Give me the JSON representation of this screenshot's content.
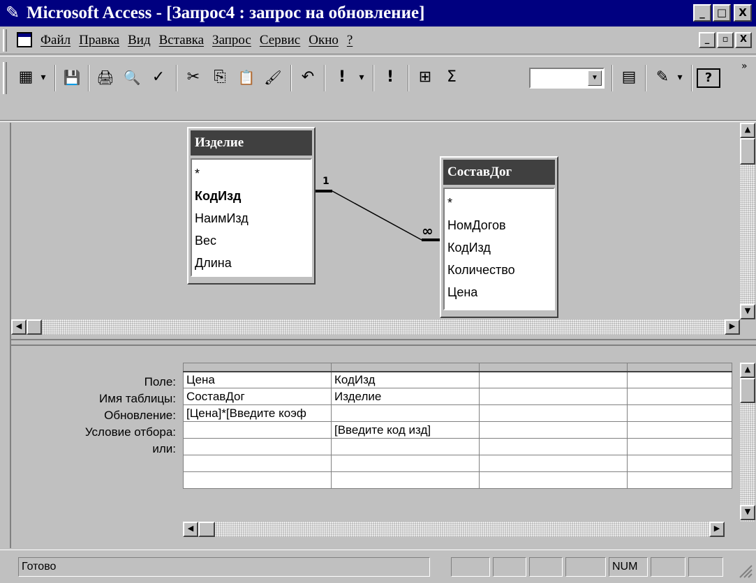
{
  "window": {
    "title": "Microsoft Access - [Запрос4 : запрос на обновление]",
    "buttons": [
      "_",
      "□",
      "X"
    ]
  },
  "menubar": {
    "items": [
      "Файл",
      "Правка",
      "Вид",
      "Вставка",
      "Запрос",
      "Сервис",
      "Окно",
      "?"
    ],
    "mdi_buttons": [
      "_",
      "▫",
      "X"
    ]
  },
  "toolbar": {
    "buttons": [
      {
        "name": "view-icon",
        "glyph": "▦"
      },
      {
        "name": "dropdown-arrow-icon",
        "glyph": "▾"
      },
      {
        "name": "save-icon",
        "glyph": "💾"
      },
      {
        "name": "print-icon",
        "glyph": "🖨"
      },
      {
        "name": "print-preview-icon",
        "glyph": "🔍"
      },
      {
        "name": "spelling-icon",
        "glyph": "✓"
      },
      {
        "name": "cut-icon",
        "glyph": "✂"
      },
      {
        "name": "copy-icon",
        "glyph": "⎘"
      },
      {
        "name": "paste-icon",
        "glyph": "📋"
      },
      {
        "name": "format-painter-icon",
        "glyph": "🖌"
      },
      {
        "name": "undo-icon",
        "glyph": "↶"
      },
      {
        "name": "query-type-icon",
        "glyph": "!"
      },
      {
        "name": "run-icon",
        "glyph": "!"
      },
      {
        "name": "show-table-icon",
        "glyph": "⊞"
      },
      {
        "name": "totals-icon",
        "glyph": "Σ"
      },
      {
        "name": "properties-icon",
        "glyph": "▤"
      },
      {
        "name": "build-icon",
        "glyph": "✎"
      },
      {
        "name": "help-icon",
        "glyph": "?"
      }
    ],
    "more": "»"
  },
  "tables": [
    {
      "name": "Изделие",
      "fields": [
        "*",
        "КодИзд",
        "НаимИзд",
        "Вес",
        "Длина"
      ],
      "key": "КодИзд"
    },
    {
      "name": "СоставДог",
      "fields": [
        "*",
        "НомДогов",
        "КодИзд",
        "Количество",
        "Цена"
      ],
      "key": ""
    }
  ],
  "relationship": {
    "one": "1",
    "many": "∞"
  },
  "grid": {
    "row_labels": [
      "Поле:",
      "Имя таблицы:",
      "Обновление:",
      "Условие отбора:",
      "или:"
    ],
    "rows": [
      [
        "Цена",
        "КодИзд",
        "",
        ""
      ],
      [
        "СоставДог",
        "Изделие",
        "",
        ""
      ],
      [
        "[Цена]*[Введите коэф",
        "",
        "",
        ""
      ],
      [
        "",
        "[Введите код изд]",
        "",
        ""
      ],
      [
        "",
        "",
        "",
        ""
      ],
      [
        "",
        "",
        "",
        ""
      ],
      [
        "",
        "",
        "",
        ""
      ]
    ]
  },
  "statusbar": {
    "text": "Готово",
    "num": "NUM"
  }
}
